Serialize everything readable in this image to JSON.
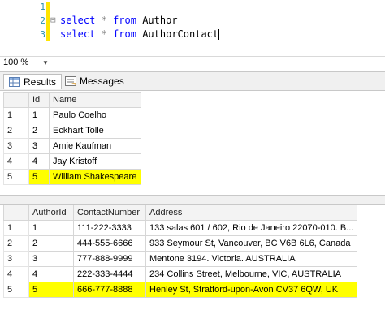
{
  "editor": {
    "line_numbers": [
      "1",
      "2",
      "3"
    ],
    "lines": [
      {
        "kw1": "select",
        "op": "*",
        "kw2": "from",
        "table": "Author"
      },
      {
        "kw1": "select",
        "op": "*",
        "kw2": "from",
        "table": "AuthorContact"
      }
    ],
    "collapse_glyph": "⊟"
  },
  "toolbar": {
    "zoom": "100 %"
  },
  "tabs": [
    {
      "label": "Results",
      "icon": "results-grid-icon"
    },
    {
      "label": "Messages",
      "icon": "messages-icon"
    }
  ],
  "grid1": {
    "headers": [
      "Id",
      "Name"
    ],
    "rows": [
      {
        "rn": "1",
        "cells": [
          "1",
          "Paulo Coelho"
        ]
      },
      {
        "rn": "2",
        "cells": [
          "2",
          "Eckhart Tolle"
        ]
      },
      {
        "rn": "3",
        "cells": [
          "3",
          "Amie Kaufman"
        ]
      },
      {
        "rn": "4",
        "cells": [
          "4",
          "Jay Kristoff"
        ]
      },
      {
        "rn": "5",
        "cells": [
          "5",
          "William Shakespeare"
        ]
      }
    ]
  },
  "grid2": {
    "headers": [
      "AuthorId",
      "ContactNumber",
      "Address"
    ],
    "rows": [
      {
        "rn": "1",
        "cells": [
          "1",
          "111-222-3333",
          "133 salas 601 / 602, Rio de Janeiro 22070-010. B..."
        ]
      },
      {
        "rn": "2",
        "cells": [
          "2",
          "444-555-6666",
          "933 Seymour St, Vancouver, BC V6B 6L6, Canada"
        ]
      },
      {
        "rn": "3",
        "cells": [
          "3",
          "777-888-9999",
          "Mentone 3194. Victoria. AUSTRALIA"
        ]
      },
      {
        "rn": "4",
        "cells": [
          "4",
          "222-333-4444",
          "234 Collins Street, Melbourne, VIC, AUSTRALIA"
        ]
      },
      {
        "rn": "5",
        "cells": [
          "5",
          "666-777-8888",
          "Henley St, Stratford-upon-Avon CV37 6QW, UK"
        ]
      }
    ]
  },
  "colors": {
    "keyword": "#0000ff",
    "line_number": "#2b91af",
    "highlight": "#ffff00",
    "change_bar": "#ffe500"
  }
}
